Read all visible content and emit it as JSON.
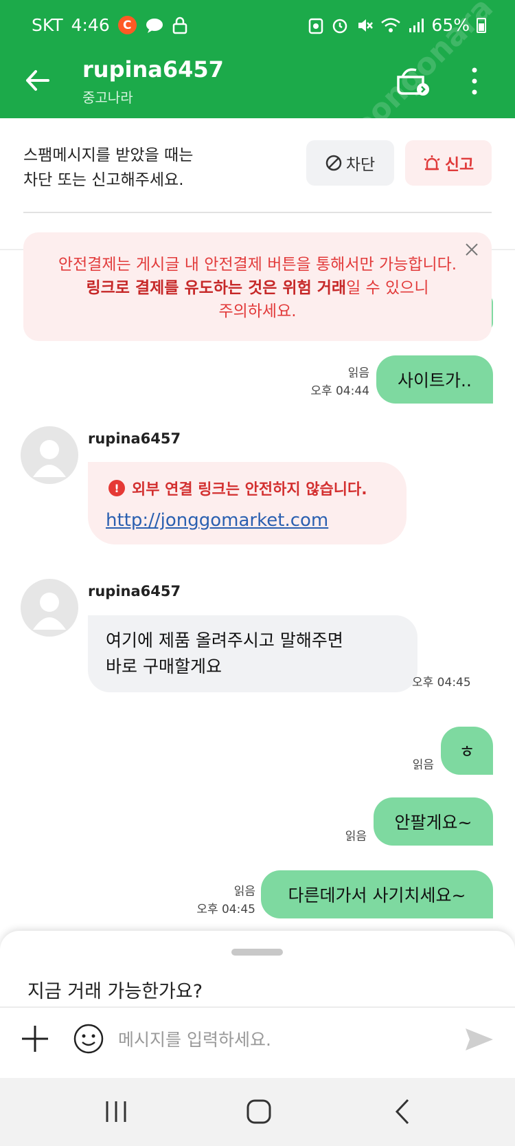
{
  "status_bar": {
    "carrier": "SKT",
    "time": "4:46",
    "badge": "C",
    "battery": "65%"
  },
  "header": {
    "title": "rupina6457",
    "subtitle": "중고나라",
    "watermark": "joongonara"
  },
  "spam_notice": {
    "line1": "스팸메시지를 받았을 때는",
    "line2": "차단 또는 신고해주세요.",
    "block_label": "차단",
    "report_label": "신고"
  },
  "safe_pay_warning": {
    "line1": "안전결제는 게시글 내 안전결제 버튼을 통해서만 가능합니다.",
    "line2_bold": "링크로 결제를 유도하는 것은 위험 거래",
    "line2_rest": "일 수 있으니",
    "line3": "주의하세요."
  },
  "messages": [
    {
      "direction": "out",
      "text": "사이트가..",
      "read": "읽음",
      "time": "오후 04:44"
    },
    {
      "direction": "in",
      "sender": "rupina6457",
      "warning": "외부 연결 링크는 안전하지 않습니다.",
      "link": "http://jonggomarket.com"
    },
    {
      "direction": "in",
      "sender": "rupina6457",
      "line1": "여기에 제품 올려주시고 말해주면",
      "line2": "바로 구매할게요",
      "time": "오후 04:45"
    },
    {
      "direction": "out",
      "text": "ㅎ",
      "read": "읽음"
    },
    {
      "direction": "out",
      "text": "안팔게요~",
      "read": "읽음"
    },
    {
      "direction": "out",
      "text": "다른데가서 사기치세요~",
      "read": "읽음",
      "time": "오후 04:45"
    }
  ],
  "composer": {
    "quick_reply": "지금 거래 가능한가요?",
    "placeholder": "메시지를 입력하세요."
  },
  "icons": [
    "back-arrow-icon",
    "wallet-icon",
    "more-vertical-icon",
    "block-icon",
    "siren-icon",
    "close-icon",
    "info-icon",
    "plus-icon",
    "emoji-icon",
    "send-icon",
    "recent-apps-icon",
    "home-icon",
    "back-nav-icon"
  ],
  "colors": {
    "brand_green": "#1caa4a",
    "outgoing_bubble": "#7ed9a0",
    "warning_red": "#e23b3b"
  }
}
